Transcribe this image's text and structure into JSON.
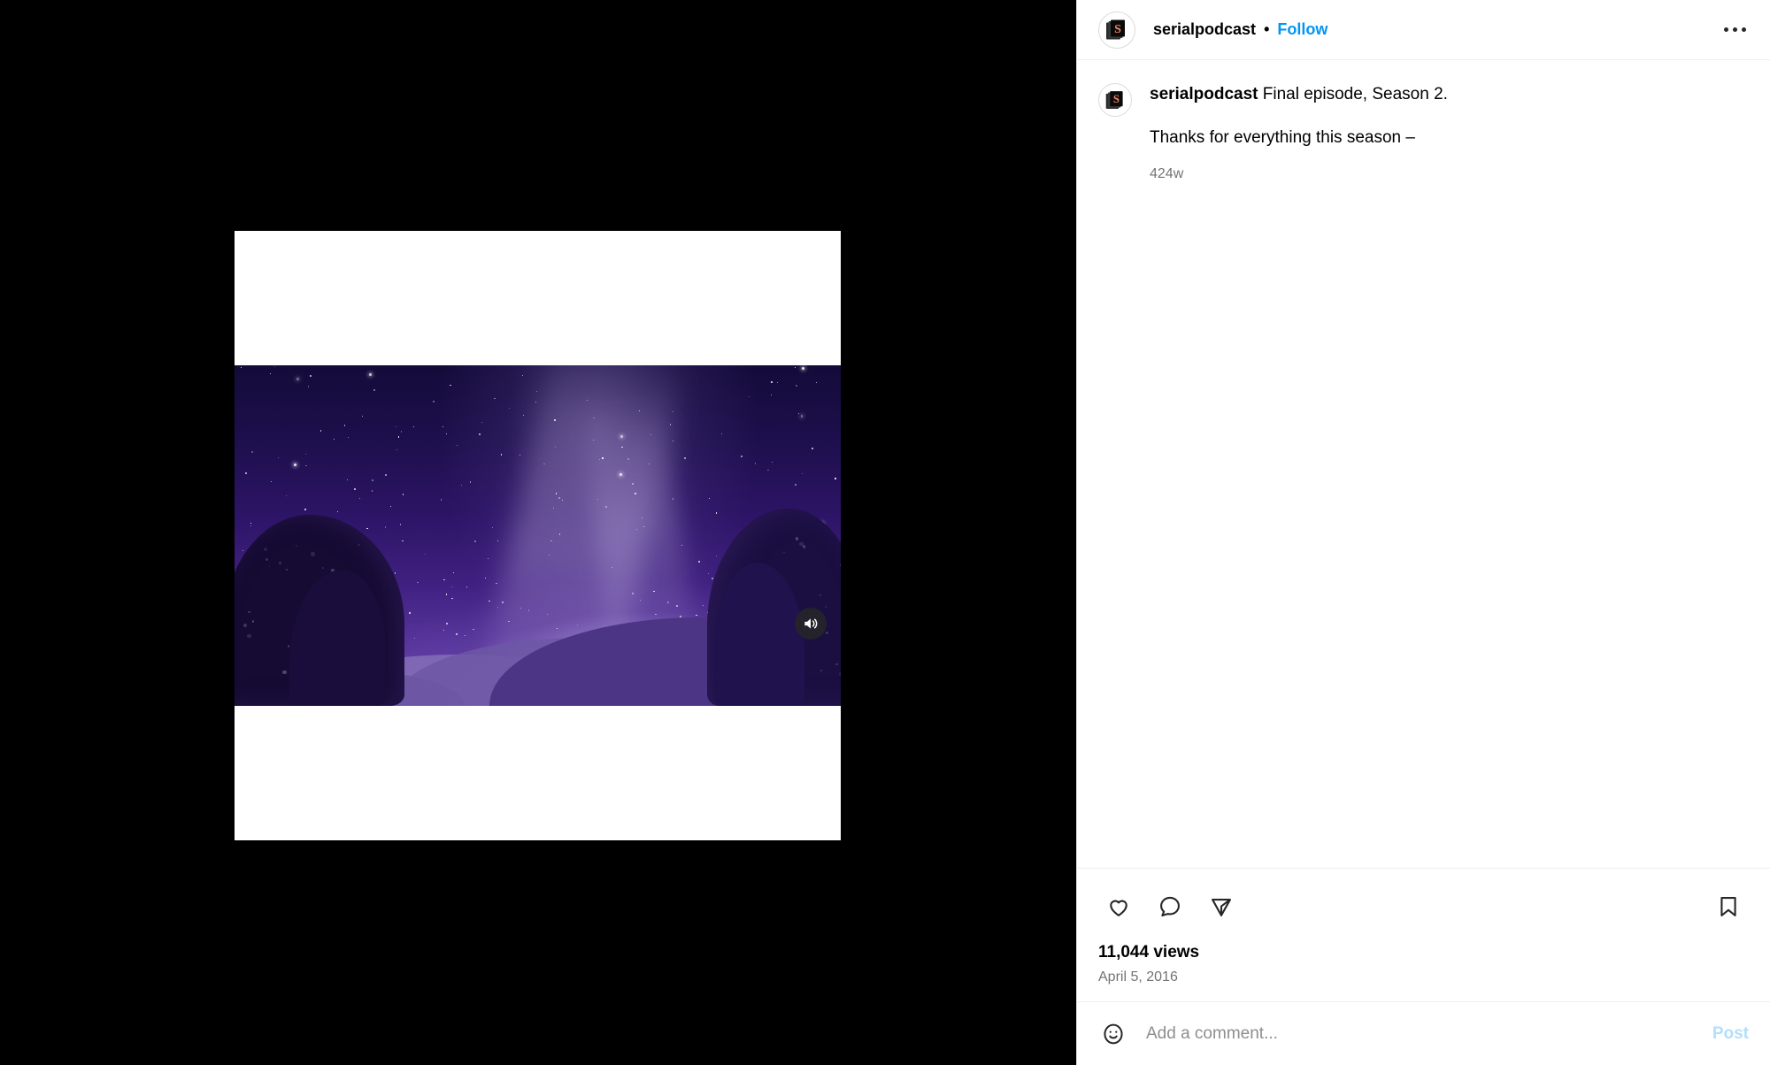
{
  "header": {
    "username": "serialpodcast",
    "separator": "•",
    "follow_label": "Follow",
    "more_icon": "ellipsis-icon",
    "avatar_icon": "serial-podcast-avatar"
  },
  "caption": {
    "username": "serialpodcast",
    "text": "Final episode, Season 2.",
    "body": "Thanks for everything this season –",
    "timestamp": "424w"
  },
  "media": {
    "type": "video",
    "audio_icon": "audio-on-icon",
    "audio_state": "unmuted",
    "scene": "night-sky-with-trees-and-hills"
  },
  "actions": {
    "like_icon": "heart-icon",
    "comment_icon": "comment-bubble-icon",
    "share_icon": "share-paper-plane-icon",
    "save_icon": "bookmark-icon",
    "views": "11,044 views",
    "date": "April 5, 2016"
  },
  "comment_box": {
    "emoji_icon": "emoji-smiley-icon",
    "placeholder": "Add a comment...",
    "value": "",
    "post_label": "Post"
  },
  "colors": {
    "link_blue": "#0095f6",
    "post_disabled": "#b2dffc",
    "secondary_text": "#737373",
    "border": "#efefef",
    "background": "#ffffff",
    "media_background": "#000000"
  }
}
